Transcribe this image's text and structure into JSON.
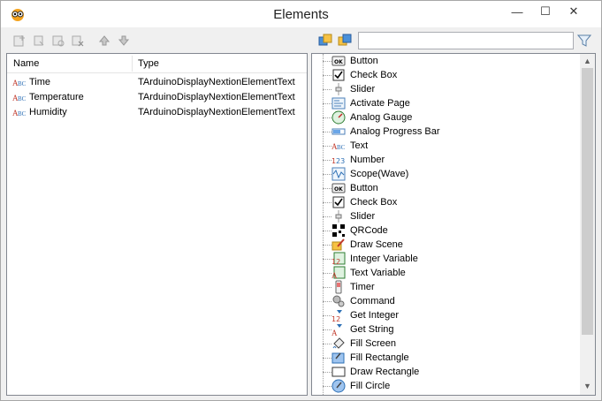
{
  "window": {
    "title": "Elements",
    "controls": {
      "minimize": "—",
      "maximize": "☐",
      "close": "✕"
    }
  },
  "toolbar": {
    "buttons": [
      {
        "icon": "add-element-icon"
      },
      {
        "icon": "duplicate-element-icon"
      },
      {
        "icon": "properties-icon"
      },
      {
        "icon": "delete-element-icon"
      },
      {
        "icon": "arrow-up-icon"
      },
      {
        "icon": "arrow-down-icon"
      }
    ],
    "right_buttons": [
      {
        "icon": "expand-all-icon"
      },
      {
        "icon": "collapse-all-icon"
      }
    ],
    "search_value": "",
    "filter_icon": "filter-icon"
  },
  "elements_table": {
    "headers": [
      "Name",
      "Type"
    ],
    "rows": [
      {
        "name": "Time",
        "type": "TArduinoDisplayNextionElementText"
      },
      {
        "name": "Temperature",
        "type": "TArduinoDisplayNextionElementText"
      },
      {
        "name": "Humidity",
        "type": "TArduinoDisplayNextionElementText"
      }
    ]
  },
  "palette": {
    "items": [
      {
        "label": "Button",
        "icon": "button-icon"
      },
      {
        "label": "Check Box",
        "icon": "checkbox-icon"
      },
      {
        "label": "Slider",
        "icon": "slider-icon"
      },
      {
        "label": "Activate Page",
        "icon": "page-icon"
      },
      {
        "label": "Analog Gauge",
        "icon": "gauge-icon"
      },
      {
        "label": "Analog Progress Bar",
        "icon": "progress-bar-icon"
      },
      {
        "label": "Text",
        "icon": "text-icon"
      },
      {
        "label": "Number",
        "icon": "number-icon"
      },
      {
        "label": "Scope(Wave)",
        "icon": "scope-icon"
      },
      {
        "label": "Button",
        "icon": "button-icon"
      },
      {
        "label": "Check Box",
        "icon": "checkbox-icon"
      },
      {
        "label": "Slider",
        "icon": "slider-icon"
      },
      {
        "label": "QRCode",
        "icon": "qrcode-icon"
      },
      {
        "label": "Draw Scene",
        "icon": "draw-scene-icon"
      },
      {
        "label": "Integer Variable",
        "icon": "integer-variable-icon"
      },
      {
        "label": "Text Variable",
        "icon": "text-variable-icon"
      },
      {
        "label": "Timer",
        "icon": "timer-icon"
      },
      {
        "label": "Command",
        "icon": "command-icon"
      },
      {
        "label": "Get Integer",
        "icon": "get-integer-icon"
      },
      {
        "label": "Get String",
        "icon": "get-string-icon"
      },
      {
        "label": "Fill Screen",
        "icon": "fill-screen-icon"
      },
      {
        "label": "Fill Rectangle",
        "icon": "fill-rectangle-icon"
      },
      {
        "label": "Draw Rectangle",
        "icon": "draw-rectangle-icon"
      },
      {
        "label": "Fill Circle",
        "icon": "fill-circle-icon"
      }
    ]
  }
}
